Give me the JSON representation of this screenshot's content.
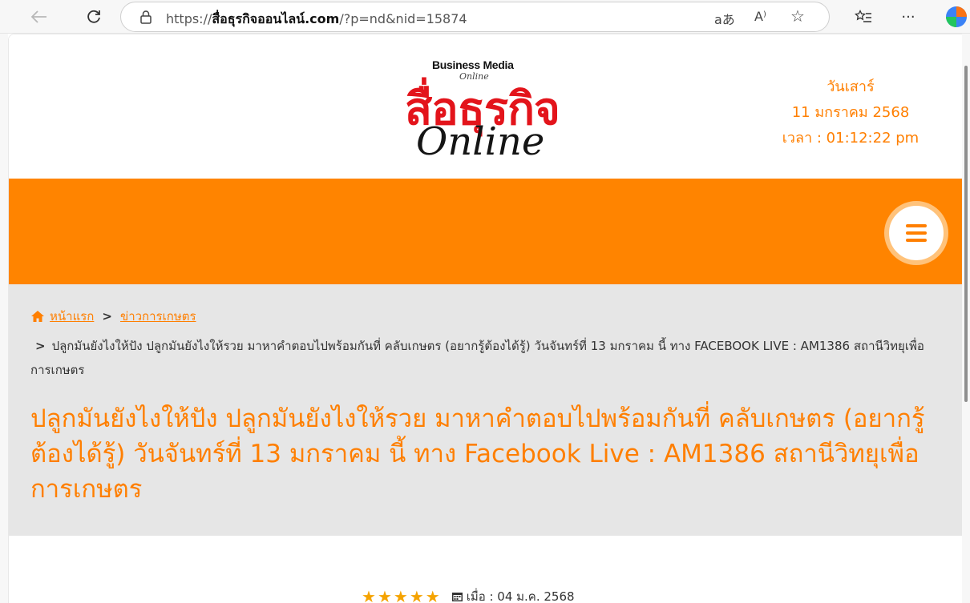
{
  "browser": {
    "url_prefix": "https://",
    "url_domain": "สื่อธุรกิจออนไลน์.com",
    "url_path": "/?p=nd&nid=15874",
    "read_aloud_label": "aあ",
    "reader_label": "A⁾",
    "more_label": "···"
  },
  "logo": {
    "business_media": "Business Media",
    "online_small": "Online",
    "thai_name": "สื่อธุรกิจ",
    "online_script": "Online"
  },
  "header": {
    "day": "วันเสาร์",
    "date": "11 มกราคม 2568",
    "time": "เวลา : 01:12:22 pm"
  },
  "breadcrumb": {
    "home": "หน้าแรก",
    "category": "ข่าวการเกษตร",
    "current": "ปลูกมันยังไงให้ปัง ปลูกมันยังไงให้รวย มาหาคำตอบไปพร้อมกันที่ คลับเกษตร (อยากรู้ต้องได้รู้) วันจันทร์ที่ 13 มกราคม นี้ ทาง FACEBOOK LIVE : AM1386 สถานีวิทยุเพื่อการเกษตร"
  },
  "article": {
    "title": "ปลูกมันยังไงให้ปัง ปลูกมันยังไงให้รวย มาหาคำตอบไปพร้อมกันที่ คลับเกษตร (อยากรู้ต้องได้รู้) วันจันทร์ที่ 13 มกราคม นี้ ทาง Facebook Live : AM1386 สถานีวิทยุเพื่อการเกษตร",
    "rating": 5,
    "date": "เมื่อ : 04 ม.ค. 2568"
  },
  "colors": {
    "accent": "#ff7f00",
    "bar": "#ff8400",
    "logo_red": "#e3141b",
    "crumb_bg": "#e6e6e6",
    "star": "#f5a300"
  }
}
